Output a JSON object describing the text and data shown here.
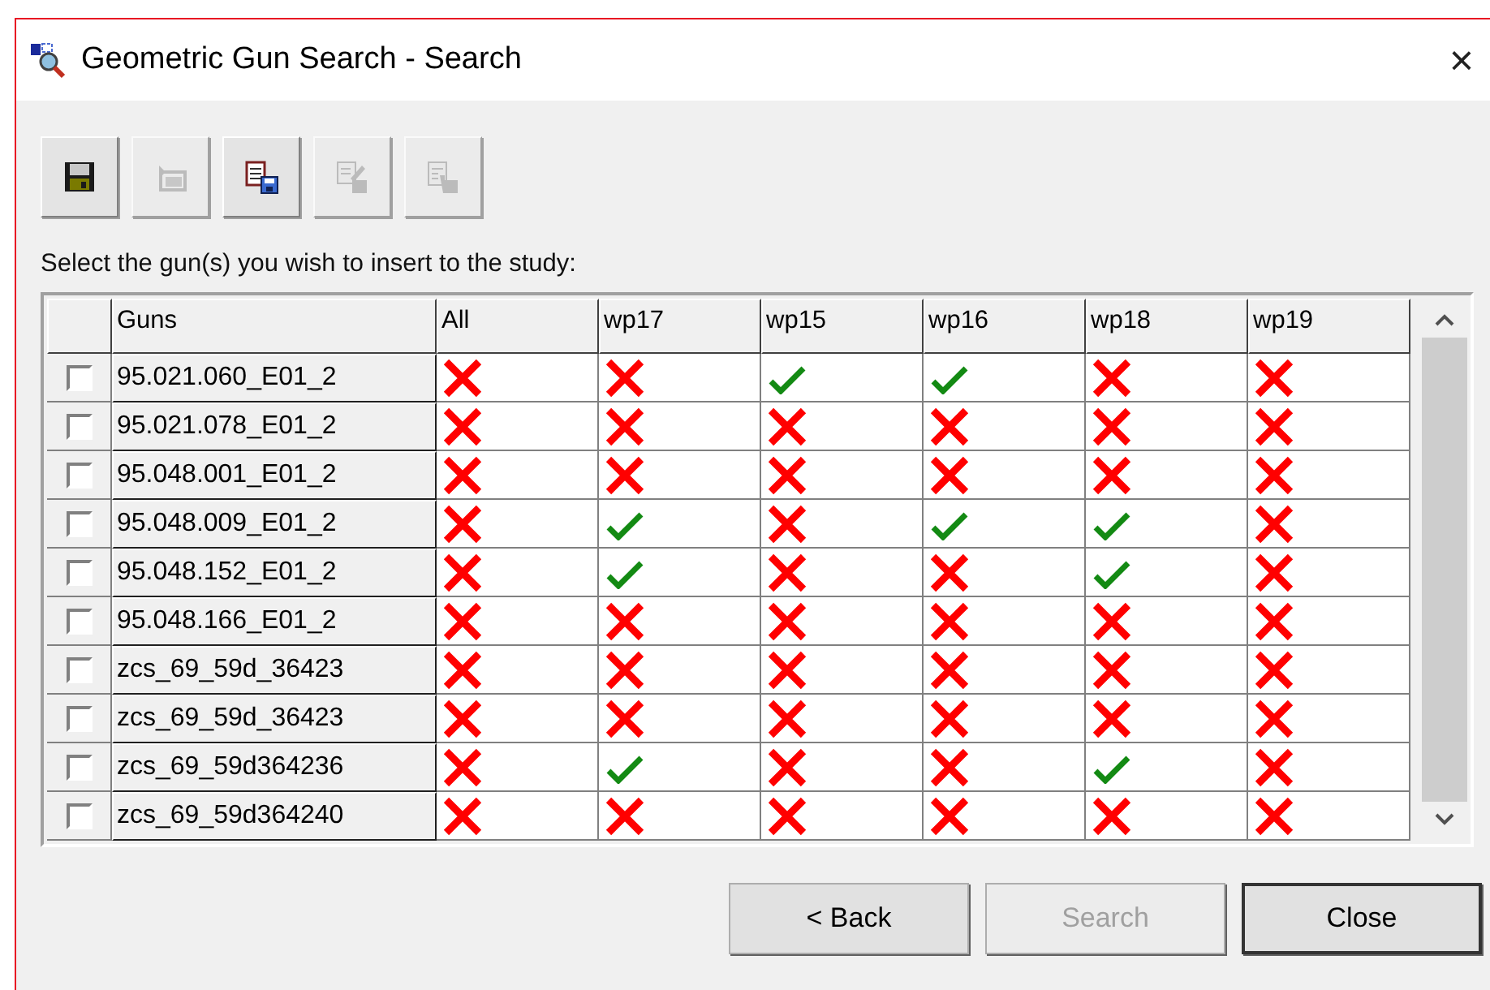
{
  "window": {
    "title": "Geometric Gun Search - Search",
    "close": "×"
  },
  "toolbar": [
    {
      "kind": "save",
      "disabled": false
    },
    {
      "kind": "open",
      "disabled": true
    },
    {
      "kind": "save-as",
      "disabled": false
    },
    {
      "kind": "edit",
      "disabled": true
    },
    {
      "kind": "pick",
      "disabled": true
    }
  ],
  "prompt": "Select the gun(s) you wish to insert to the study:",
  "table": {
    "columns": [
      "Guns",
      "All",
      "wp17",
      "wp15",
      "wp16",
      "wp18",
      "wp19"
    ],
    "rows": [
      {
        "checked": false,
        "gun": "95.021.060_E01_2",
        "ok": [
          false,
          false,
          true,
          true,
          false,
          false
        ]
      },
      {
        "checked": false,
        "gun": "95.021.078_E01_2",
        "ok": [
          false,
          false,
          false,
          false,
          false,
          false
        ]
      },
      {
        "checked": false,
        "gun": "95.048.001_E01_2",
        "ok": [
          false,
          false,
          false,
          false,
          false,
          false
        ]
      },
      {
        "checked": false,
        "gun": "95.048.009_E01_2",
        "ok": [
          false,
          true,
          false,
          true,
          true,
          false
        ]
      },
      {
        "checked": false,
        "gun": "95.048.152_E01_2",
        "ok": [
          false,
          true,
          false,
          false,
          true,
          false
        ]
      },
      {
        "checked": false,
        "gun": "95.048.166_E01_2",
        "ok": [
          false,
          false,
          false,
          false,
          false,
          false
        ]
      },
      {
        "checked": false,
        "gun": "zcs_69_59d_36423",
        "ok": [
          false,
          false,
          false,
          false,
          false,
          false
        ]
      },
      {
        "checked": false,
        "gun": "zcs_69_59d_36423",
        "ok": [
          false,
          false,
          false,
          false,
          false,
          false
        ]
      },
      {
        "checked": false,
        "gun": "zcs_69_59d364236",
        "ok": [
          false,
          true,
          false,
          false,
          true,
          false
        ]
      },
      {
        "checked": false,
        "gun": "zcs_69_59d364240",
        "ok": [
          false,
          false,
          false,
          false,
          false,
          false
        ]
      }
    ]
  },
  "buttons": [
    {
      "label": "< Back",
      "disabled": false,
      "selected": false
    },
    {
      "label": "Search",
      "disabled": true,
      "selected": false
    },
    {
      "label": "Close",
      "disabled": false,
      "selected": true
    }
  ]
}
